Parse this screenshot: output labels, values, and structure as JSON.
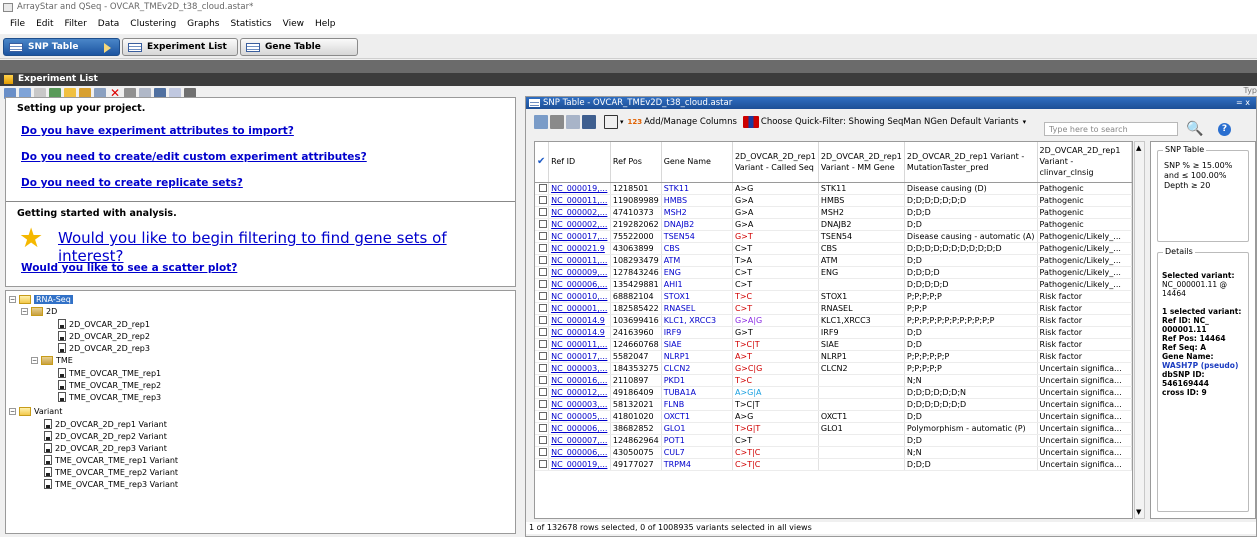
{
  "window": {
    "title": "ArrayStar and QSeq - OVCAR_TMEv2D_t38_cloud.astar*"
  },
  "menu": [
    "File",
    "Edit",
    "Filter",
    "Data",
    "Clustering",
    "Graphs",
    "Statistics",
    "View",
    "Help"
  ],
  "view_tabs": [
    "SNP Table",
    "Experiment List",
    "Gene Table"
  ],
  "experiment_list": {
    "title": "Experiment List",
    "type_hint": "Typ",
    "setup_heading": "Setting up your project.",
    "setup_links": [
      "Do you have experiment attributes to import?",
      "Do you need to create/edit custom experiment attributes?",
      "Do you need to create replicate sets?"
    ],
    "analysis_heading": "Getting started with analysis.",
    "filter_link": "Would you like to begin filtering to find gene sets of interest?",
    "scatter_link": "Would you like to see a scatter plot?"
  },
  "tree": {
    "root": "RNA-Seq",
    "group_2d": "2D",
    "items_2d": [
      "2D_OVCAR_2D_rep1",
      "2D_OVCAR_2D_rep2",
      "2D_OVCAR_2D_rep3"
    ],
    "group_tme": "TME",
    "items_tme": [
      "TME_OVCAR_TME_rep1",
      "TME_OVCAR_TME_rep2",
      "TME_OVCAR_TME_rep3"
    ],
    "variant_root": "Variant",
    "variant_items": [
      "2D_OVCAR_2D_rep1 Variant",
      "2D_OVCAR_2D_rep2 Variant",
      "2D_OVCAR_2D_rep3 Variant",
      "TME_OVCAR_TME_rep1 Variant",
      "TME_OVCAR_TME_rep2 Variant",
      "TME_OVCAR_TME_rep3 Variant"
    ]
  },
  "snp": {
    "title": "SNP Table - OVCAR_TMEv2D_t38_cloud.astar",
    "controls": "= x",
    "toolbar": {
      "add_manage": "Add/Manage Columns",
      "quick_filter": "Choose Quick-Filter: Showing SeqMan NGen Default Variants",
      "filter_arrow": "▾",
      "num_icon": "123",
      "search_placeholder": "Type here to search"
    },
    "headers": [
      "Ref ID",
      "Ref Pos",
      "Gene Name",
      "2D_OVCAR_2D_rep1 Variant - Called Seq",
      "2D_OVCAR_2D_rep1 Variant - MM Gene",
      "2D_OVCAR_2D_rep1 Variant - MutationTaster_pred",
      "2D_OVCAR_2D_rep1 Variant - clinvar_clnsig"
    ],
    "rows": [
      [
        "NC_000019,...",
        "1218501",
        "STK11",
        "A>G",
        "STK11",
        "Disease causing (D)",
        "Pathogenic"
      ],
      [
        "NC_000011,...",
        "119089989",
        "HMBS",
        "G>A",
        "HMBS",
        "D;D;D;D;D;D;D",
        "Pathogenic"
      ],
      [
        "NC_000002,...",
        "47410373",
        "MSH2",
        "G>A",
        "MSH2",
        "D;D;D",
        "Pathogenic"
      ],
      [
        "NC_000002,...",
        "219282062",
        "DNAJB2",
        "G>A",
        "DNAJB2",
        "D;D",
        "Pathogenic"
      ],
      [
        "NC_000017,...",
        "75522000",
        "TSEN54",
        "G>T",
        "TSEN54",
        "Disease causing - automatic (A)",
        "Pathogenic/Likely_..."
      ],
      [
        "NC_000021.9",
        "43063899",
        "CBS",
        "C>T",
        "CBS",
        "D;D;D;D;D;D;D;D;D;D;D",
        "Pathogenic/Likely_..."
      ],
      [
        "NC_000011,...",
        "108293479",
        "ATM",
        "T>A",
        "ATM",
        "D;D",
        "Pathogenic/Likely_..."
      ],
      [
        "NC_000009,...",
        "127843246",
        "ENG",
        "C>T",
        "ENG",
        "D;D;D;D",
        "Pathogenic/Likely_..."
      ],
      [
        "NC_000006,...",
        "135429881",
        "AHI1",
        "C>T",
        "",
        "D;D;D;D;D",
        "Pathogenic/Likely_..."
      ],
      [
        "NC_000010,...",
        "68882104",
        "STOX1",
        "T>C",
        "STOX1",
        "P;P;P;P;P",
        "Risk factor"
      ],
      [
        "NC_000001,...",
        "182585422",
        "RNASEL",
        "C>T",
        "RNASEL",
        "P;P;P",
        "Risk factor"
      ],
      [
        "NC_000014.9",
        "103699416",
        "KLC1, XRCC3",
        "G>A|G",
        "KLC1,XRCC3",
        "P;P;P;P;P;P;P;P;P;P;P;P",
        "Risk factor"
      ],
      [
        "NC_000014.9",
        "24163960",
        "IRF9",
        "G>T",
        "IRF9",
        "D;D",
        "Risk factor"
      ],
      [
        "NC_000011,...",
        "124660768",
        "SIAE",
        "T>C|T",
        "SIAE",
        "D;D",
        "Risk factor"
      ],
      [
        "NC_000017,...",
        "5582047",
        "NLRP1",
        "A>T",
        "NLRP1",
        "P;P;P;P;P;P",
        "Risk factor"
      ],
      [
        "NC_000003,...",
        "184353275",
        "CLCN2",
        "G>C|G",
        "CLCN2",
        "P;P;P;P;P",
        "Uncertain significa..."
      ],
      [
        "NC_000016,...",
        "2110897",
        "PKD1",
        "T>C",
        "",
        "N;N",
        "Uncertain significa..."
      ],
      [
        "NC_000012,...",
        "49186409",
        "TUBA1A",
        "A>G|A",
        "",
        "D;D;D;D;D;D;N",
        "Uncertain significa..."
      ],
      [
        "NC_000003,...",
        "58132021",
        "FLNB",
        "T>C|T",
        "",
        "D;D;D;D;D;D;D",
        "Uncertain significa..."
      ],
      [
        "NC_000005,...",
        "41801020",
        "OXCT1",
        "A>G",
        "OXCT1",
        "D;D",
        "Uncertain significa..."
      ],
      [
        "NC_000006,...",
        "38682852",
        "GLO1",
        "T>G|T",
        "GLO1",
        "Polymorphism - automatic (P)",
        "Uncertain significa..."
      ],
      [
        "NC_000007,...",
        "124862964",
        "POT1",
        "C>T",
        "",
        "D;D",
        "Uncertain significa..."
      ],
      [
        "NC_000006,...",
        "43050075",
        "CUL7",
        "C>T|C",
        "",
        "N;N",
        "Uncertain significa..."
      ],
      [
        "NC_000019,...",
        "49177027",
        "TRPM4",
        "C>T|C",
        "",
        "D;D;D",
        "Uncertain significa..."
      ]
    ],
    "called_seq_colors": [
      "#000",
      "#000",
      "#000",
      "#000",
      "#d00000",
      "#000",
      "#000",
      "#000",
      "#000",
      "#d00000",
      "#d00000",
      "#8a2be2",
      "#000",
      "#d00000",
      "#d00000",
      "#d00000",
      "#d00000",
      "#1aa0e0",
      "#000",
      "#000",
      "#d00000",
      "#000",
      "#d00000",
      "#d00000"
    ],
    "side": {
      "filter_title": "SNP Table",
      "filter_text": "SNP % ≥ 15.00% and ≤ 100.00% Depth ≥ 20",
      "details_title": "Details",
      "sel_label": "Selected variant:",
      "sel_value": "NC_000001.11 @ 14464",
      "count": "1 selected variant:",
      "ref_id": "Ref ID: NC_ 000001.11",
      "ref_pos": "Ref Pos: 14464",
      "ref_seq": "Ref Seq: A",
      "gene_label": "Gene Name:",
      "gene_value": "WASH7P (pseudo)",
      "dbsnp": "dbSNP ID: 546169444",
      "cross": "cross ID: 9"
    },
    "status": "1 of 132678 rows selected, 0 of 1008935 variants selected in all views"
  }
}
